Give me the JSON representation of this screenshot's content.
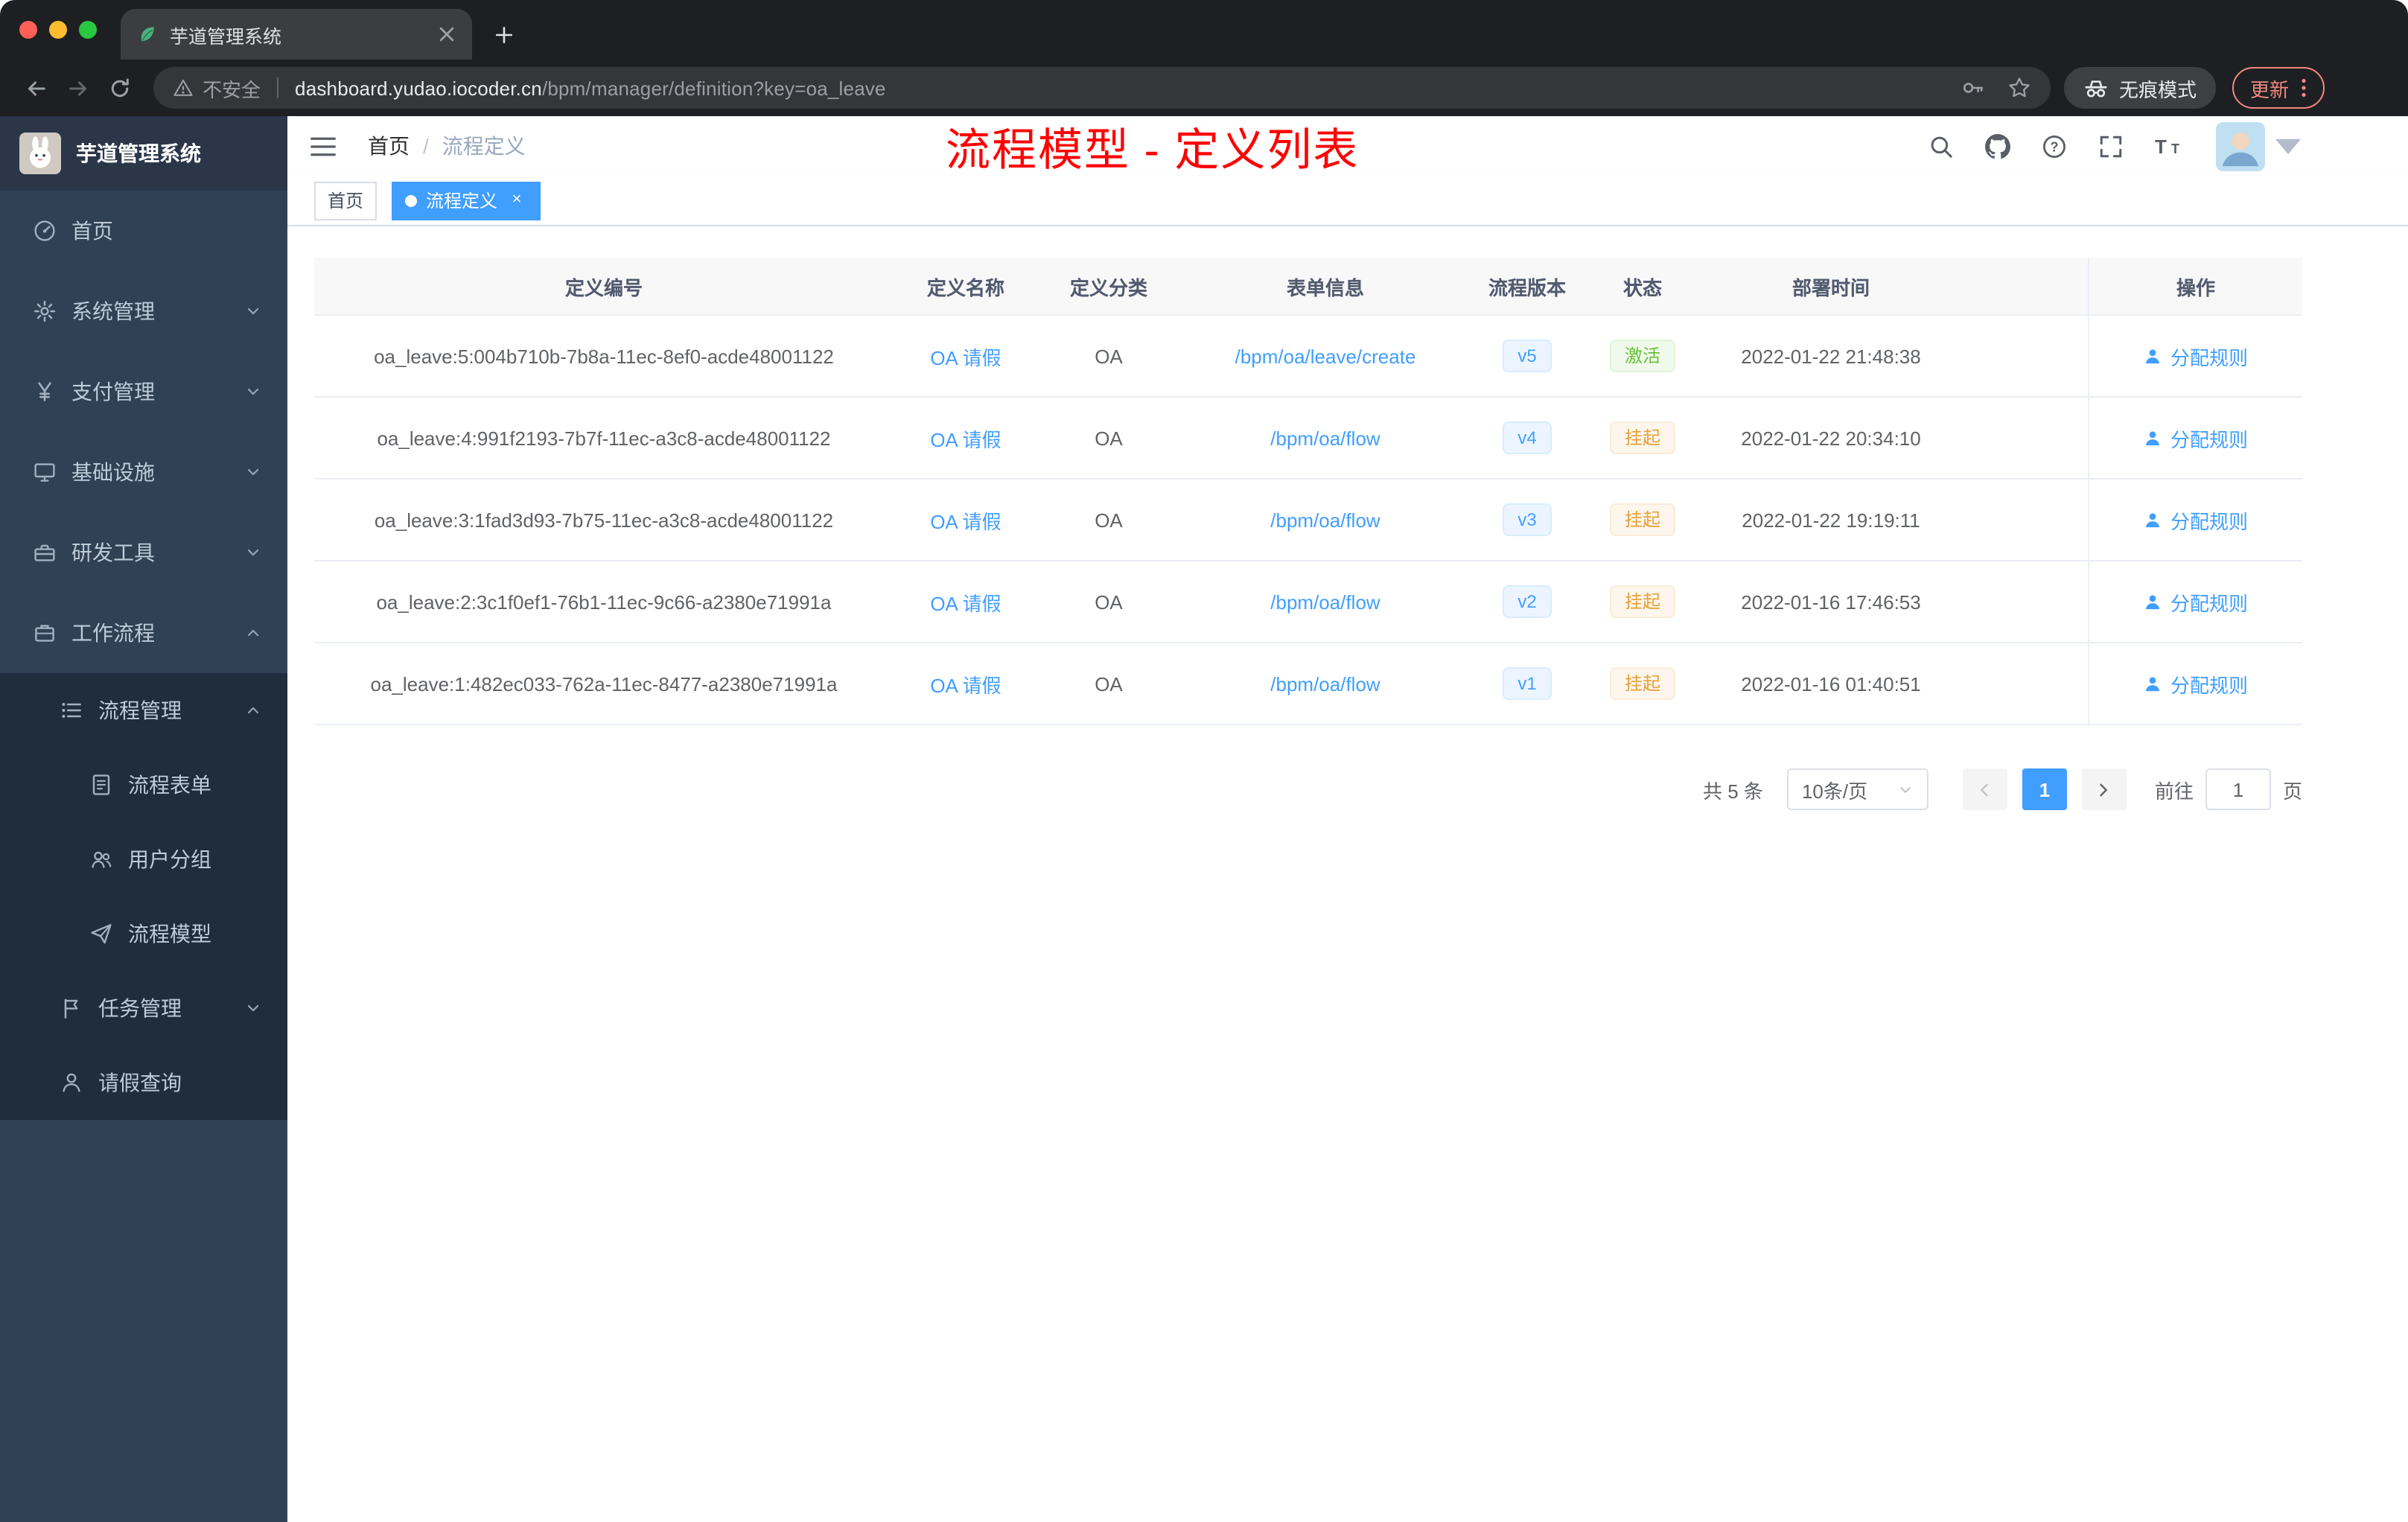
{
  "colors": {
    "accent": "#409eff",
    "annotation": "#ff0000",
    "success": "#67c23a",
    "warning": "#e6a23c",
    "sidebar_bg": "#304156",
    "submenu_bg": "#1f2d3d"
  },
  "browser": {
    "tab_title": "芋道管理系统",
    "security_label": "不安全",
    "url_domain": "dashboard.yudao.iocoder.cn",
    "url_path": "/bpm/manager/definition?key=oa_leave",
    "incognito_label": "无痕模式",
    "update_label": "更新"
  },
  "sidebar": {
    "logo_title": "芋道管理系统",
    "items": [
      {
        "key": "home",
        "label": "首页",
        "icon": "dashboard-icon",
        "depth": 0
      },
      {
        "key": "system-management",
        "label": "系统管理",
        "icon": "gear-icon",
        "depth": 0,
        "chevron": "down"
      },
      {
        "key": "payment-management",
        "label": "支付管理",
        "icon": "yen-icon",
        "depth": 0,
        "chevron": "down"
      },
      {
        "key": "infrastructure",
        "label": "基础设施",
        "icon": "infra-icon",
        "depth": 0,
        "chevron": "down"
      },
      {
        "key": "dev-tools",
        "label": "研发工具",
        "icon": "tools-icon",
        "depth": 0,
        "chevron": "down"
      },
      {
        "key": "workflow",
        "label": "工作流程",
        "icon": "workflow-icon",
        "depth": 0,
        "chevron": "up"
      },
      {
        "key": "process-management",
        "label": "流程管理",
        "icon": "process-icon",
        "depth": 1,
        "sub": true,
        "chevron": "up"
      },
      {
        "key": "process-form",
        "label": "流程表单",
        "icon": "form-icon",
        "depth": 2,
        "sub": true
      },
      {
        "key": "user-group",
        "label": "用户分组",
        "icon": "group-icon",
        "depth": 2,
        "sub": true
      },
      {
        "key": "process-model",
        "label": "流程模型",
        "icon": "model-icon",
        "depth": 2,
        "sub": true
      },
      {
        "key": "task-management",
        "label": "任务管理",
        "icon": "task-icon",
        "depth": 1,
        "sub": true,
        "chevron": "down"
      },
      {
        "key": "leave-query",
        "label": "请假查询",
        "icon": "person-icon",
        "depth": 1,
        "sub": true
      }
    ]
  },
  "navbar": {
    "breadcrumb": [
      "首页",
      "流程定义"
    ],
    "breadcrumb_separator": "/",
    "annotation": "流程模型 - 定义列表"
  },
  "tags": [
    {
      "label": "首页",
      "active": false,
      "closable": false
    },
    {
      "label": "流程定义",
      "active": true,
      "closable": true
    }
  ],
  "table": {
    "columns": [
      "定义编号",
      "定义名称",
      "定义分类",
      "表单信息",
      "流程版本",
      "状态",
      "部署时间",
      "操作"
    ],
    "rows": [
      {
        "id": "oa_leave:5:004b710b-7b8a-11ec-8ef0-acde48001122",
        "name": "OA 请假",
        "category": "OA",
        "form": "/bpm/oa/leave/create",
        "version": "v5",
        "status": "激活",
        "status_type": "success",
        "time": "2022-01-22 21:48:38",
        "action": "分配规则"
      },
      {
        "id": "oa_leave:4:991f2193-7b7f-11ec-a3c8-acde48001122",
        "name": "OA 请假",
        "category": "OA",
        "form": "/bpm/oa/flow",
        "version": "v4",
        "status": "挂起",
        "status_type": "warning",
        "time": "2022-01-22 20:34:10",
        "action": "分配规则"
      },
      {
        "id": "oa_leave:3:1fad3d93-7b75-11ec-a3c8-acde48001122",
        "name": "OA 请假",
        "category": "OA",
        "form": "/bpm/oa/flow",
        "version": "v3",
        "status": "挂起",
        "status_type": "warning",
        "time": "2022-01-22 19:19:11",
        "action": "分配规则"
      },
      {
        "id": "oa_leave:2:3c1f0ef1-76b1-11ec-9c66-a2380e71991a",
        "name": "OA 请假",
        "category": "OA",
        "form": "/bpm/oa/flow",
        "version": "v2",
        "status": "挂起",
        "status_type": "warning",
        "time": "2022-01-16 17:46:53",
        "action": "分配规则"
      },
      {
        "id": "oa_leave:1:482ec033-762a-11ec-8477-a2380e71991a",
        "name": "OA 请假",
        "category": "OA",
        "form": "/bpm/oa/flow",
        "version": "v1",
        "status": "挂起",
        "status_type": "warning",
        "time": "2022-01-16 01:40:51",
        "action": "分配规则"
      }
    ]
  },
  "pagination": {
    "total": "共 5 条",
    "page_size": "10条/页",
    "current_page": "1",
    "goto_label": "前往",
    "goto_value": "1",
    "page_unit": "页"
  }
}
